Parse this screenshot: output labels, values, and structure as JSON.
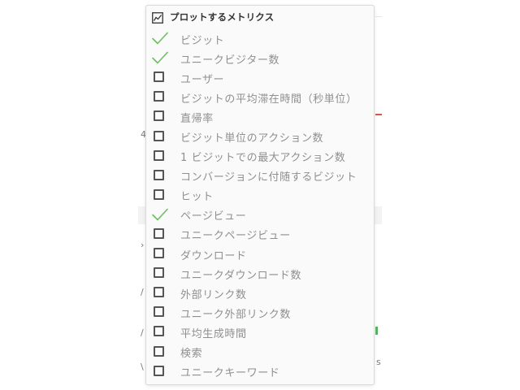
{
  "dropdown": {
    "title": "プロットするメトリクス",
    "header_icon": "line-chart-icon",
    "check_color": "#6dbf5f",
    "items": [
      {
        "label": "ビジット",
        "checked": true
      },
      {
        "label": "ユニークビジター数",
        "checked": true
      },
      {
        "label": "ユーザー",
        "checked": false
      },
      {
        "label": "ビジットの平均滞在時間（秒単位）",
        "checked": false
      },
      {
        "label": "直帰率",
        "checked": false
      },
      {
        "label": "ビジット単位のアクション数",
        "checked": false
      },
      {
        "label": "1 ビジットでの最大アクション数",
        "checked": false
      },
      {
        "label": "コンバージョンに付随するビジット",
        "checked": false
      },
      {
        "label": "ヒット",
        "checked": false
      },
      {
        "label": "ページビュー",
        "checked": true
      },
      {
        "label": "ユニークページビュー",
        "checked": false
      },
      {
        "label": "ダウンロード",
        "checked": false
      },
      {
        "label": "ユニークダウンロード数",
        "checked": false
      },
      {
        "label": "外部リンク数",
        "checked": false
      },
      {
        "label": "ユニーク外部リンク数",
        "checked": false
      },
      {
        "label": "平均生成時間",
        "checked": false
      },
      {
        "label": "検索",
        "checked": false
      },
      {
        "label": "ユニークキーワード",
        "checked": false
      }
    ]
  },
  "background": {
    "left_fragments": [
      "4",
      "›",
      "/",
      "/",
      "\\"
    ],
    "right_fragments": [
      "s"
    ]
  }
}
